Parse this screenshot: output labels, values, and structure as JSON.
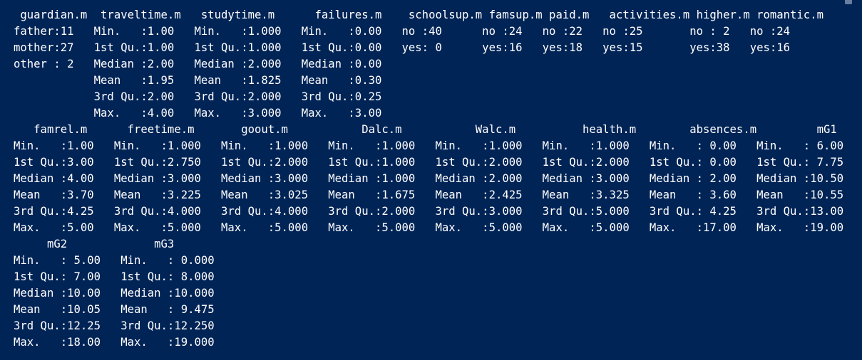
{
  "console": {
    "lines": [
      " guardian.m  traveltime.m   studytime.m      failures.m    schoolsup.m famsup.m paid.m   activities.m higher.m romantic.m",
      "father:11   Min.   :1.00   Min.   :1.000   Min.   :0.00   no :40      no :24   no :22   no :25       no : 2   no :24",
      "mother:27   1st Qu.:1.00   1st Qu.:1.000   1st Qu.:0.00   yes: 0      yes:16   yes:18   yes:15       yes:38   yes:16",
      "other : 2   Median :2.00   Median :2.000   Median :0.00",
      "            Mean   :1.95   Mean   :1.825   Mean   :0.30",
      "            3rd Qu.:2.00   3rd Qu.:2.000   3rd Qu.:0.25",
      "            Max.   :4.00   Max.   :3.000   Max.   :3.00",
      "   famrel.m      freetime.m       goout.m           Dalc.m           Walc.m          health.m        absences.m         mG1",
      "Min.   :1.00   Min.   :1.000   Min.   :1.000   Min.   :1.000   Min.   :1.000   Min.   :1.000   Min.   : 0.00   Min.   : 6.00",
      "1st Qu.:3.00   1st Qu.:2.750   1st Qu.:2.000   1st Qu.:1.000   1st Qu.:2.000   1st Qu.:2.000   1st Qu.: 0.00   1st Qu.: 7.75",
      "Median :4.00   Median :3.000   Median :3.000   Median :1.000   Median :2.000   Median :3.000   Median : 2.00   Median :10.50",
      "Mean   :3.70   Mean   :3.225   Mean   :3.025   Mean   :1.675   Mean   :2.425   Mean   :3.325   Mean   : 3.60   Mean   :10.55",
      "3rd Qu.:4.25   3rd Qu.:4.000   3rd Qu.:4.000   3rd Qu.:2.000   3rd Qu.:3.000   3rd Qu.:5.000   3rd Qu.: 4.25   3rd Qu.:13.00",
      "Max.   :5.00   Max.   :5.000   Max.   :5.000   Max.   :5.000   Max.   :5.000   Max.   :5.000   Max.   :17.00   Max.   :19.00",
      "     mG2             mG3",
      "Min.   : 5.00   Min.   : 0.000",
      "1st Qu.: 7.00   1st Qu.: 8.000",
      "Median :10.00   Median :10.000",
      "Mean   :10.05   Mean   : 9.475",
      "3rd Qu.:12.25   3rd Qu.:12.250",
      "Max.   :18.00   Max.   :19.000"
    ]
  },
  "colors": {
    "background": "#012456",
    "text": "#ffffff"
  }
}
